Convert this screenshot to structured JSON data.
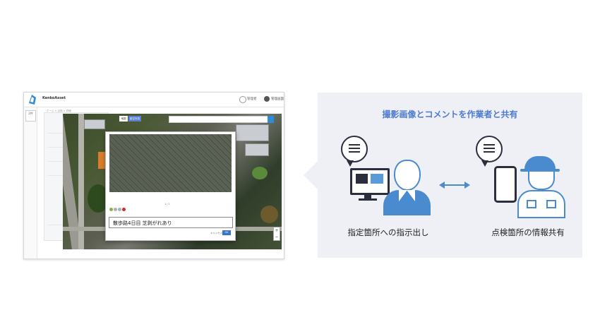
{
  "screenshot": {
    "app_name": "KenkoAsset",
    "user_name": "管理者",
    "settings_label": "管理画面",
    "rail_label": "2件",
    "breadcrumb": "ホーム > 点検 > 詳細",
    "map_tabs": [
      "地図",
      "航空写真"
    ],
    "dialog_page": "1 / 1",
    "comment": "散歩路4日目 芝剥がれあり",
    "cancel_label": "キャンセル",
    "ok_label": "OK",
    "zoom": "+ −"
  },
  "diagram": {
    "title": "撮影画像とコメントを作業者と共有",
    "left_label": "指定箇所への指示出し",
    "right_label": "点検箇所の情報共有"
  },
  "colors": {
    "accent_blue": "#4a8bcf",
    "title_blue": "#4e7bd0",
    "dark_navy": "#2b2f3d",
    "diagram_bg": "#eef0f5"
  },
  "icons": [
    "speech-bubble-icon",
    "monitor-icon",
    "office-worker-icon",
    "double-arrow-icon",
    "smartphone-icon",
    "field-worker-helmet-icon"
  ]
}
